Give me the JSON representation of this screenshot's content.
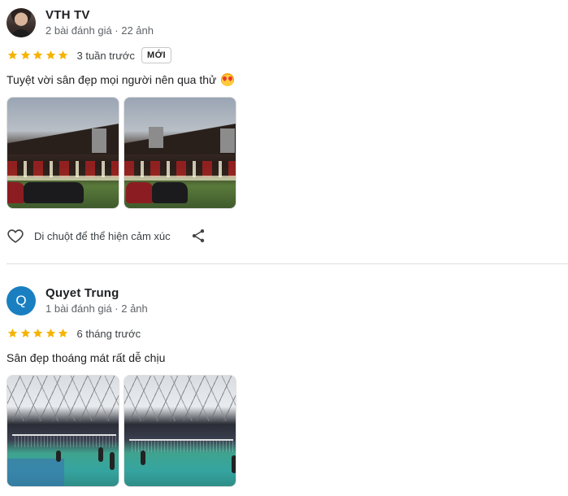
{
  "reviews": [
    {
      "author": "VTH TV",
      "meta": "2 bài đánh giá · 22 ảnh",
      "avatar": {
        "type": "photo",
        "icon": "user-photo"
      },
      "rating": 5,
      "time_ago": "3 tuần trước",
      "badge": "MỚI",
      "text": "Tuyệt vời sân đẹp mọi người nên qua thử",
      "emoji": "heart-eyes-emoji",
      "photos": [
        "night-building-photo",
        "night-building-photo"
      ],
      "actions": {
        "react_label": "Di chuột để thể hiện cảm xúc",
        "react_icon": "heart-outline-icon",
        "share_icon": "share-icon"
      }
    },
    {
      "author": "Quyet Trung",
      "meta": "1 bài đánh giá · 2 ảnh",
      "avatar": {
        "type": "letter",
        "letter": "Q",
        "color": "#1a7fc1"
      },
      "rating": 5,
      "time_ago": "6 tháng trước",
      "text": "Sân đẹp thoáng mát rất dễ chịu",
      "photos": [
        "pickleball-court-photo",
        "pickleball-court-photo"
      ]
    }
  ],
  "colors": {
    "star": "#f5b400",
    "text": "#202124",
    "muted": "#5f6368",
    "divider": "#dadce0"
  }
}
